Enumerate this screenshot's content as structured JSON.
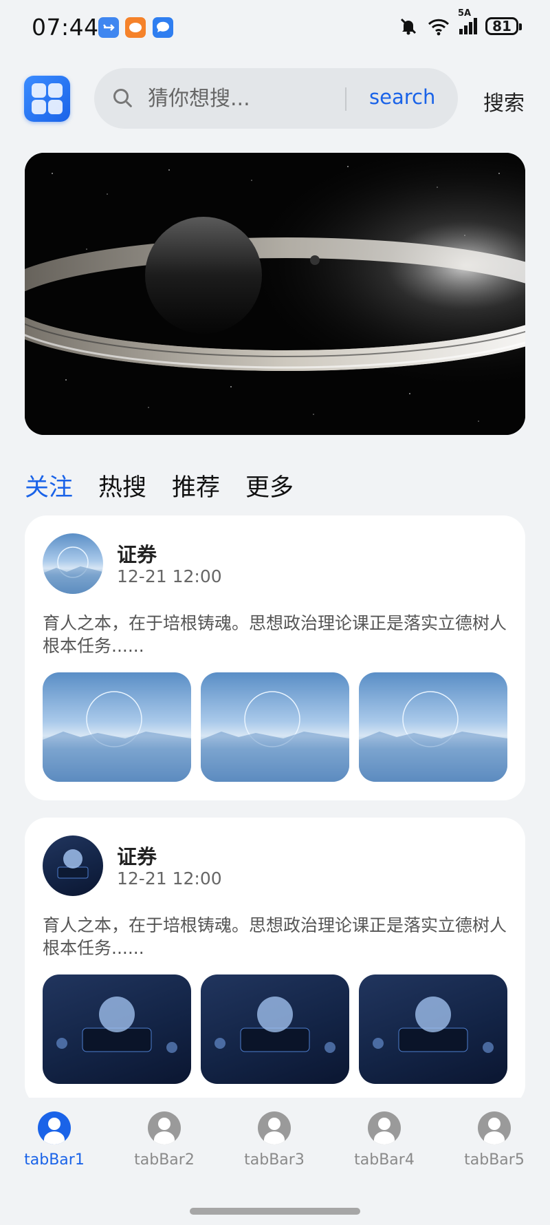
{
  "status_bar": {
    "time": "07:44",
    "network": "5A",
    "battery": "81",
    "icons": [
      "usb-icon",
      "orange-app-icon",
      "message-app-icon",
      "mute-bell-icon",
      "wifi-icon",
      "signal-icon",
      "battery-icon"
    ]
  },
  "header": {
    "search_placeholder": "猜你想搜...",
    "search_button": "search",
    "search_text_button": "搜索"
  },
  "tabs": [
    {
      "label": "关注",
      "active": true
    },
    {
      "label": "热搜",
      "active": false
    },
    {
      "label": "推荐",
      "active": false
    },
    {
      "label": "更多",
      "active": false
    }
  ],
  "posts": [
    {
      "title": "证券",
      "date": "12-21 12:00",
      "text": "育人之本，在于培根铸魂。思想政治理论课正是落实立德树人根本任务......",
      "image_theme": "ocean-ring"
    },
    {
      "title": "证券",
      "date": "12-21 12:00",
      "text": "育人之本，在于培根铸魂。思想政治理论课正是落实立德树人根本任务......",
      "image_theme": "tech-chip"
    }
  ],
  "tabbar": [
    {
      "label": "tabBar1",
      "active": true
    },
    {
      "label": "tabBar2",
      "active": false
    },
    {
      "label": "tabBar3",
      "active": false
    },
    {
      "label": "tabBar4",
      "active": false
    },
    {
      "label": "tabBar5",
      "active": false
    }
  ],
  "colors": {
    "accent": "#1a63e8",
    "background": "#f1f3f5",
    "card": "#ffffff"
  }
}
